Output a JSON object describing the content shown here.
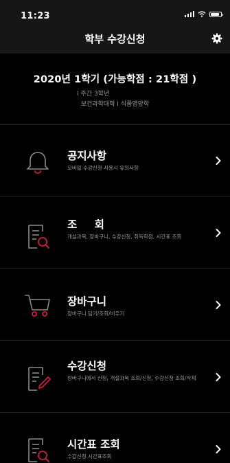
{
  "status_bar": {
    "time": "11:23"
  },
  "nav": {
    "title": "학부 수강신청"
  },
  "semester": {
    "title": "2020년 1학기 (가능학점 : 21학점 )",
    "grade": "I 주간  3학년",
    "major": "보건과학대학 I 식품영양학"
  },
  "menu": [
    {
      "title": "공지사항",
      "desc": "모바일 수강신청 사용시 유의사항",
      "icon": "bell-icon"
    },
    {
      "title": "조 회",
      "desc": "개설과목, 장바구니, 수강신청, 취득학점, 시간표 조회",
      "icon": "document-search-icon"
    },
    {
      "title": "장바구니",
      "desc": "장바구니 담기/조회/비우기",
      "icon": "cart-icon"
    },
    {
      "title": "수강신청",
      "desc": "장바구니에서 신청, 개설과목 조회/신청, 수강신청 조회/삭제",
      "icon": "document-edit-icon"
    },
    {
      "title": "시간표 조회",
      "desc": "수강신청 시간표조회",
      "icon": "document-search-icon"
    }
  ],
  "colors": {
    "accent": "#c8203a",
    "icon_gray": "#8a8a8a",
    "background": "#000000",
    "bar": "#161616"
  }
}
